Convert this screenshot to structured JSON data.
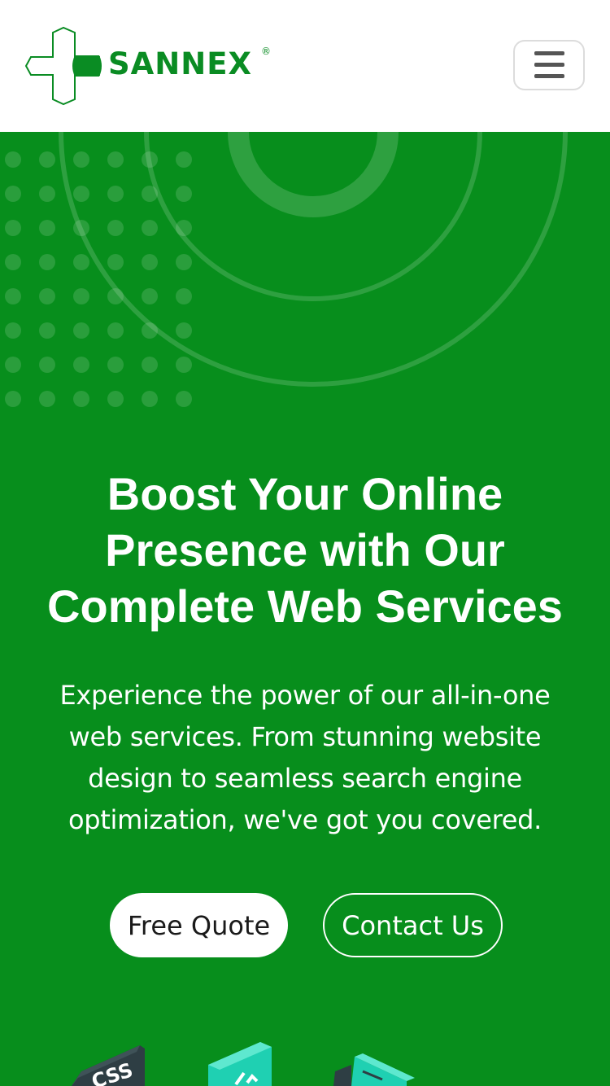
{
  "header": {
    "brand": "SANNEX",
    "registered_mark": "®",
    "menu_icon": "hamburger-menu-icon"
  },
  "hero": {
    "title": "Boost Your Online Presence with Our Complete Web Services",
    "subtitle": "Experience the power of our all-in-one web services. From stunning website design to seamless search engine optimization, we've got you covered.",
    "primary_button": "Free Quote",
    "secondary_button": "Contact Us",
    "illustration_icons": [
      "css-file-icon",
      "code-file-icon",
      "browser-window-icon"
    ]
  },
  "colors": {
    "brand_green": "#0a8c23",
    "hero_background": "#078e1c",
    "text_on_hero": "#ffffff"
  }
}
